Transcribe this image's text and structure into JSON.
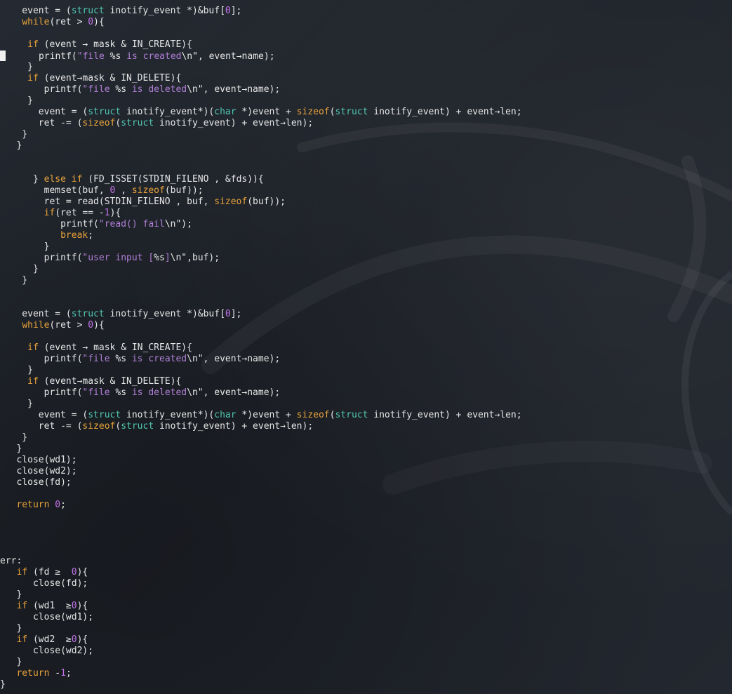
{
  "editor": {
    "theme_colors": {
      "background": "#20242b",
      "keyword": "#e9a33a",
      "type": "#50c6b0",
      "string": "#b07fd6",
      "number": "#c173e6",
      "text": "#e6e6e6"
    },
    "lines": [
      [
        [
          "pl",
          "    event = ("
        ],
        [
          "ty",
          "struct"
        ],
        [
          "pl",
          " inotify_event *)&buf["
        ],
        [
          "num",
          "0"
        ],
        [
          "pl",
          "];"
        ]
      ],
      [
        [
          "pl",
          "    "
        ],
        [
          "kw",
          "while"
        ],
        [
          "pl",
          "(ret > "
        ],
        [
          "num",
          "0"
        ],
        [
          "pl",
          "){"
        ]
      ],
      [
        [
          "pl",
          ""
        ]
      ],
      [
        [
          "pl",
          "     "
        ],
        [
          "kw",
          "if"
        ],
        [
          "pl",
          " (event → mask & IN_CREATE){"
        ]
      ],
      [
        [
          "cur",
          ""
        ],
        [
          "pl",
          "      printf("
        ],
        [
          "str",
          "\"file "
        ],
        [
          "pl",
          "%s"
        ],
        [
          "str",
          " is created"
        ],
        [
          "pl",
          "\\n\", event→name);"
        ]
      ],
      [
        [
          "pl",
          "     }"
        ]
      ],
      [
        [
          "pl",
          "     "
        ],
        [
          "kw",
          "if"
        ],
        [
          "pl",
          " (event→mask & IN_DELETE){"
        ]
      ],
      [
        [
          "pl",
          "        printf("
        ],
        [
          "str",
          "\"file "
        ],
        [
          "pl",
          "%s"
        ],
        [
          "str",
          " is deleted"
        ],
        [
          "pl",
          "\\n\", event→name);"
        ]
      ],
      [
        [
          "pl",
          "     }"
        ]
      ],
      [
        [
          "pl",
          "       event = ("
        ],
        [
          "ty",
          "struct"
        ],
        [
          "pl",
          " inotify_event*)("
        ],
        [
          "ty",
          "char"
        ],
        [
          "pl",
          " *)event + "
        ],
        [
          "kw",
          "sizeof"
        ],
        [
          "pl",
          "("
        ],
        [
          "ty",
          "struct"
        ],
        [
          "pl",
          " inotify_event) + event→len;"
        ]
      ],
      [
        [
          "pl",
          "       ret -= ("
        ],
        [
          "kw",
          "sizeof"
        ],
        [
          "pl",
          "("
        ],
        [
          "ty",
          "struct"
        ],
        [
          "pl",
          " inotify_event) + event→len);"
        ]
      ],
      [
        [
          "pl",
          "    }"
        ]
      ],
      [
        [
          "pl",
          "   }"
        ]
      ],
      [
        [
          "pl",
          ""
        ]
      ],
      [
        [
          "pl",
          ""
        ]
      ],
      [
        [
          "pl",
          "      } "
        ],
        [
          "kw",
          "else if"
        ],
        [
          "pl",
          " (FD_ISSET(STDIN_FILENO , &fds)){"
        ]
      ],
      [
        [
          "pl",
          "        memset(buf, "
        ],
        [
          "num",
          "0"
        ],
        [
          "pl",
          " , "
        ],
        [
          "kw",
          "sizeof"
        ],
        [
          "pl",
          "(buf));"
        ]
      ],
      [
        [
          "pl",
          "        ret = read(STDIN_FILENO , buf, "
        ],
        [
          "kw",
          "sizeof"
        ],
        [
          "pl",
          "(buf));"
        ]
      ],
      [
        [
          "pl",
          "        "
        ],
        [
          "kw",
          "if"
        ],
        [
          "pl",
          "(ret == -"
        ],
        [
          "num",
          "1"
        ],
        [
          "pl",
          "){"
        ]
      ],
      [
        [
          "pl",
          "           printf("
        ],
        [
          "str",
          "\"read() fail"
        ],
        [
          "pl",
          "\\n\");"
        ]
      ],
      [
        [
          "pl",
          "           "
        ],
        [
          "kw",
          "break"
        ],
        [
          "pl",
          ";"
        ]
      ],
      [
        [
          "pl",
          "        }"
        ]
      ],
      [
        [
          "pl",
          "        printf("
        ],
        [
          "str",
          "\"user input ["
        ],
        [
          "pl",
          "%s"
        ],
        [
          "str",
          "]"
        ],
        [
          "pl",
          "\\n\",buf);"
        ]
      ],
      [
        [
          "pl",
          "      }"
        ]
      ],
      [
        [
          "pl",
          "    }"
        ]
      ],
      [
        [
          "pl",
          ""
        ]
      ],
      [
        [
          "pl",
          ""
        ]
      ],
      [
        [
          "pl",
          "    event = ("
        ],
        [
          "ty",
          "struct"
        ],
        [
          "pl",
          " inotify_event *)&buf["
        ],
        [
          "num",
          "0"
        ],
        [
          "pl",
          "];"
        ]
      ],
      [
        [
          "pl",
          "    "
        ],
        [
          "kw",
          "while"
        ],
        [
          "pl",
          "(ret > "
        ],
        [
          "num",
          "0"
        ],
        [
          "pl",
          "){"
        ]
      ],
      [
        [
          "pl",
          ""
        ]
      ],
      [
        [
          "pl",
          "     "
        ],
        [
          "kw",
          "if"
        ],
        [
          "pl",
          " (event → mask & IN_CREATE){"
        ]
      ],
      [
        [
          "pl",
          "        printf("
        ],
        [
          "str",
          "\"file "
        ],
        [
          "pl",
          "%s"
        ],
        [
          "str",
          " is created"
        ],
        [
          "pl",
          "\\n\", event→name);"
        ]
      ],
      [
        [
          "pl",
          "     }"
        ]
      ],
      [
        [
          "pl",
          "     "
        ],
        [
          "kw",
          "if"
        ],
        [
          "pl",
          " (event→mask & IN_DELETE){"
        ]
      ],
      [
        [
          "pl",
          "        printf("
        ],
        [
          "str",
          "\"file "
        ],
        [
          "pl",
          "%s"
        ],
        [
          "str",
          " is deleted"
        ],
        [
          "pl",
          "\\n\", event→name);"
        ]
      ],
      [
        [
          "pl",
          "     }"
        ]
      ],
      [
        [
          "pl",
          "       event = ("
        ],
        [
          "ty",
          "struct"
        ],
        [
          "pl",
          " inotify_event*)("
        ],
        [
          "ty",
          "char"
        ],
        [
          "pl",
          " *)event + "
        ],
        [
          "kw",
          "sizeof"
        ],
        [
          "pl",
          "("
        ],
        [
          "ty",
          "struct"
        ],
        [
          "pl",
          " inotify_event) + event→len;"
        ]
      ],
      [
        [
          "pl",
          "       ret -= ("
        ],
        [
          "kw",
          "sizeof"
        ],
        [
          "pl",
          "("
        ],
        [
          "ty",
          "struct"
        ],
        [
          "pl",
          " inotify_event) + event→len);"
        ]
      ],
      [
        [
          "pl",
          "    }"
        ]
      ],
      [
        [
          "pl",
          "   }"
        ]
      ],
      [
        [
          "pl",
          "   close(wd1);"
        ]
      ],
      [
        [
          "pl",
          "   close(wd2);"
        ]
      ],
      [
        [
          "pl",
          "   close(fd);"
        ]
      ],
      [
        [
          "pl",
          ""
        ]
      ],
      [
        [
          "pl",
          "   "
        ],
        [
          "kw",
          "return"
        ],
        [
          "pl",
          " "
        ],
        [
          "num",
          "0"
        ],
        [
          "pl",
          ";"
        ]
      ],
      [
        [
          "pl",
          ""
        ]
      ],
      [
        [
          "pl",
          ""
        ]
      ],
      [
        [
          "pl",
          ""
        ]
      ],
      [
        [
          "pl",
          ""
        ]
      ],
      [
        [
          "pl",
          "err:"
        ]
      ],
      [
        [
          "pl",
          "   "
        ],
        [
          "kw",
          "if"
        ],
        [
          "pl",
          " (fd ≥  "
        ],
        [
          "num",
          "0"
        ],
        [
          "pl",
          "){"
        ]
      ],
      [
        [
          "pl",
          "      close(fd);"
        ]
      ],
      [
        [
          "pl",
          "   }"
        ]
      ],
      [
        [
          "pl",
          "   "
        ],
        [
          "kw",
          "if"
        ],
        [
          "pl",
          " (wd1  ≥"
        ],
        [
          "num",
          "0"
        ],
        [
          "pl",
          "){"
        ]
      ],
      [
        [
          "pl",
          "      close(wd1);"
        ]
      ],
      [
        [
          "pl",
          "   }"
        ]
      ],
      [
        [
          "pl",
          "   "
        ],
        [
          "kw",
          "if"
        ],
        [
          "pl",
          " (wd2  ≥"
        ],
        [
          "num",
          "0"
        ],
        [
          "pl",
          "){"
        ]
      ],
      [
        [
          "pl",
          "      close(wd2);"
        ]
      ],
      [
        [
          "pl",
          "   }"
        ]
      ],
      [
        [
          "pl",
          "   "
        ],
        [
          "kw",
          "return"
        ],
        [
          "pl",
          " -"
        ],
        [
          "num",
          "1"
        ],
        [
          "pl",
          ";"
        ]
      ],
      [
        [
          "pl",
          "}"
        ]
      ]
    ]
  }
}
